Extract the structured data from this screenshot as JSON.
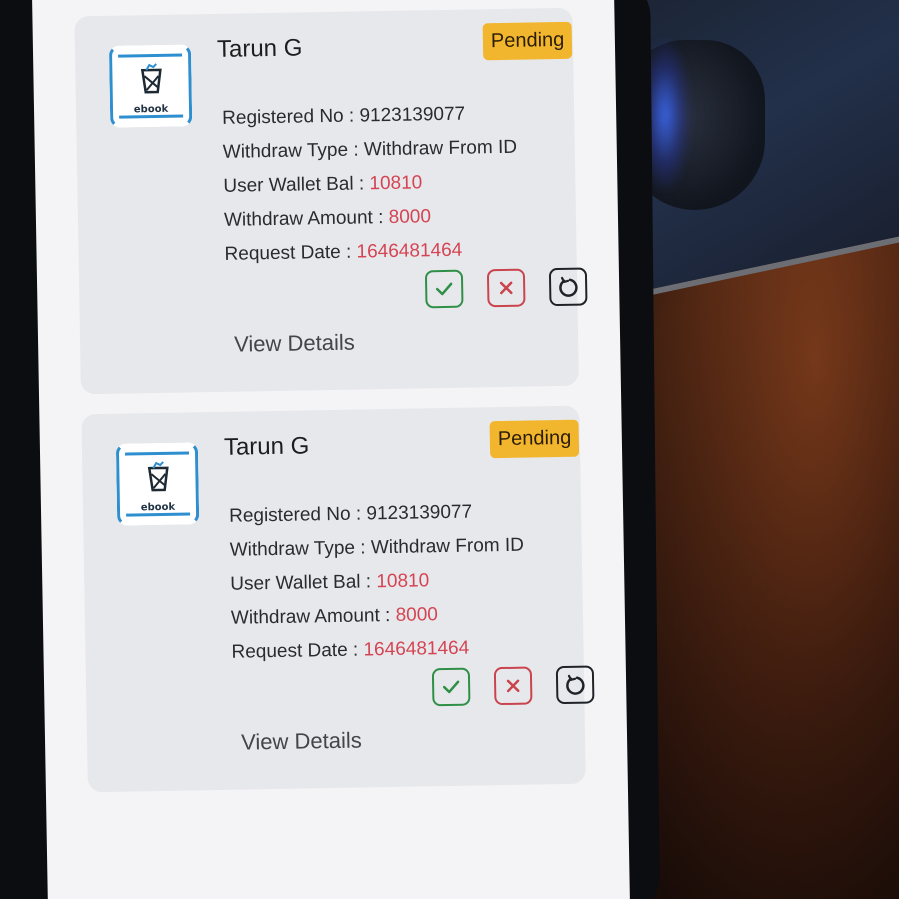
{
  "colors": {
    "pending_badge": "#f2b62e",
    "value_red": "#d44452",
    "approve_green": "#2f8f46",
    "reject_red": "#c9444d",
    "card_bg": "#e7e8ec",
    "logo_blue": "#2e8fd0"
  },
  "requests": [
    {
      "logo_text": "ebook",
      "name": "Tarun G",
      "status": "Pending",
      "registered_label": "Registered No : ",
      "registered_value": "9123139077",
      "withdraw_type_label": "Withdraw Type : ",
      "withdraw_type_value": "Withdraw From ID",
      "wallet_label": "User Wallet Bal : ",
      "wallet_value": "10810",
      "amount_label": "Withdraw Amount : ",
      "amount_value": "8000",
      "date_label": "Request Date : ",
      "date_value": "1646481464",
      "view_label": "View Details",
      "actions": [
        "check-icon",
        "close-icon",
        "refresh-icon"
      ]
    },
    {
      "logo_text": "ebook",
      "name": "Tarun G",
      "status": "Pending",
      "registered_label": "Registered No : ",
      "registered_value": "9123139077",
      "withdraw_type_label": "Withdraw Type : ",
      "withdraw_type_value": "Withdraw From ID",
      "wallet_label": "User Wallet Bal : ",
      "wallet_value": "10810",
      "amount_label": "Withdraw Amount : ",
      "amount_value": "8000",
      "date_label": "Request Date : ",
      "date_value": "1646481464",
      "view_label": "View Details",
      "actions": [
        "check-icon",
        "close-icon",
        "refresh-icon"
      ]
    }
  ]
}
